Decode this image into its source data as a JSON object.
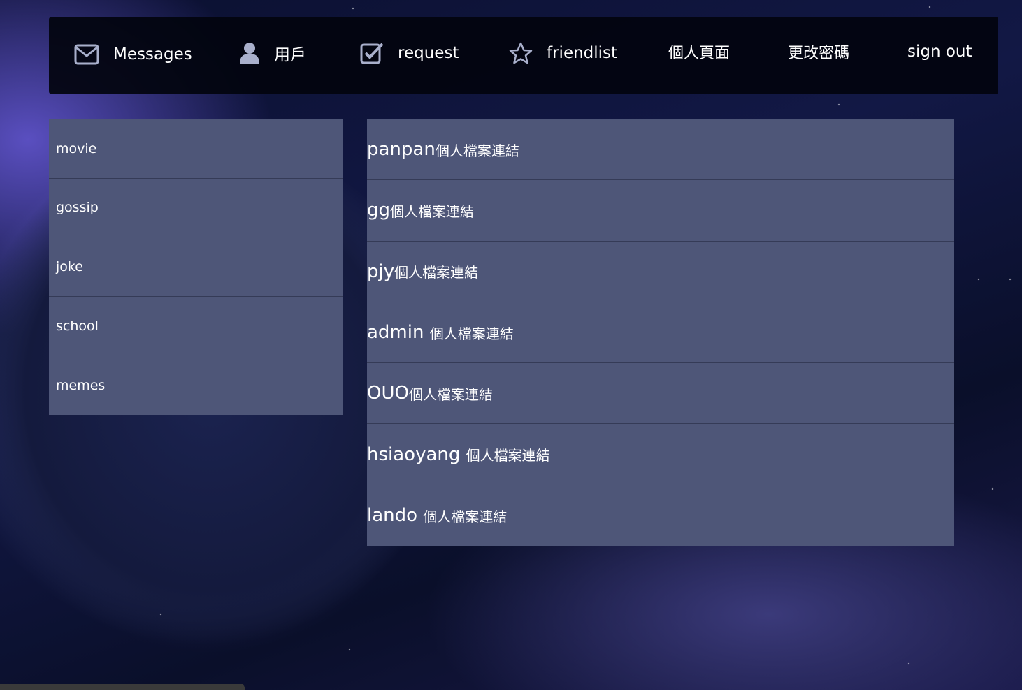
{
  "nav": {
    "messages": {
      "label": "Messages",
      "icon": "envelope-icon"
    },
    "users": {
      "label": "用戶",
      "icon": "user-icon"
    },
    "request": {
      "label": "request",
      "icon": "checkbox-icon"
    },
    "friendlist": {
      "label": "friendlist",
      "icon": "star-icon"
    },
    "profile": {
      "label": "個人頁面"
    },
    "change_password": {
      "label": "更改密碼"
    },
    "sign_out": {
      "label": "sign out"
    }
  },
  "sidebar": {
    "items": [
      {
        "label": "movie"
      },
      {
        "label": "gossip"
      },
      {
        "label": "joke"
      },
      {
        "label": "school"
      },
      {
        "label": "memes"
      }
    ]
  },
  "users": {
    "rows": [
      {
        "name": "panpan",
        "link": "個人檔案連結"
      },
      {
        "name": "gg",
        "link": "個人檔案連結"
      },
      {
        "name": "pjy",
        "link": "個人檔案連結"
      },
      {
        "name": "admin ",
        "link": "個人檔案連結"
      },
      {
        "name": "OUO",
        "link": "個人檔案連結"
      },
      {
        "name": "hsiaoyang ",
        "link": "個人檔案連結"
      },
      {
        "name": "lando ",
        "link": "個人檔案連結"
      }
    ]
  },
  "colors": {
    "panel": "#4e5678",
    "navbar": "#02040e",
    "icon": "#a9b0cc",
    "text": "#ffffff"
  }
}
